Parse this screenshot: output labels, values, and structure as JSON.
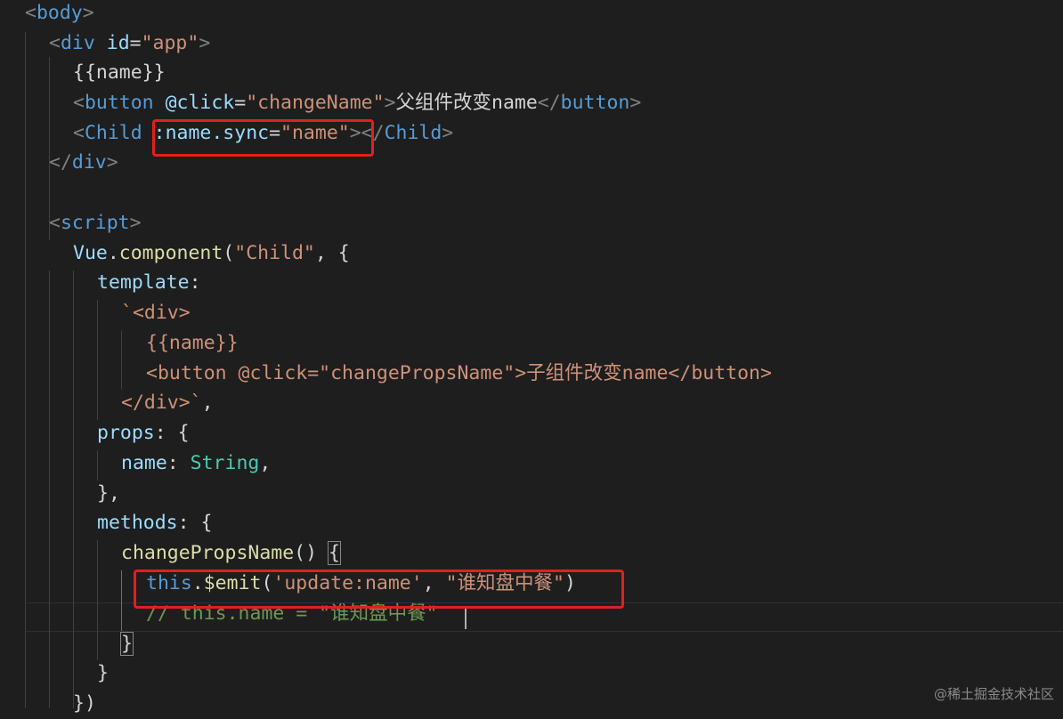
{
  "theme": {
    "background": "#1e1e1e",
    "tag": "#569cd6",
    "bracket": "#808080",
    "attribute": "#9cdcfe",
    "string": "#ce9178",
    "text": "#d4d4d4",
    "function": "#dcdcaa",
    "type": "#4ec9b0",
    "comment": "#6a9955",
    "highlight_box": "#e0201f"
  },
  "code_lines": [
    [
      {
        "t": "<",
        "c": "bracket"
      },
      {
        "t": "body",
        "c": "tag"
      },
      {
        "t": ">",
        "c": "bracket"
      }
    ],
    [
      {
        "t": "<",
        "c": "bracket"
      },
      {
        "t": "div",
        "c": "tag"
      },
      {
        "t": " "
      },
      {
        "t": "id",
        "c": "attribute"
      },
      {
        "t": "="
      },
      {
        "t": "\"app\"",
        "c": "string"
      },
      {
        "t": ">",
        "c": "bracket"
      }
    ],
    [
      {
        "t": "{{name}}"
      }
    ],
    [
      {
        "t": "<",
        "c": "bracket"
      },
      {
        "t": "button",
        "c": "tag"
      },
      {
        "t": " "
      },
      {
        "t": "@click",
        "c": "attribute"
      },
      {
        "t": "="
      },
      {
        "t": "\"changeName\"",
        "c": "string"
      },
      {
        "t": ">",
        "c": "bracket"
      },
      {
        "t": "父组件改变name"
      },
      {
        "t": "</",
        "c": "bracket"
      },
      {
        "t": "button",
        "c": "tag"
      },
      {
        "t": ">",
        "c": "bracket"
      }
    ],
    [
      {
        "t": "<",
        "c": "bracket"
      },
      {
        "t": "Child",
        "c": "tag"
      },
      {
        "t": " "
      },
      {
        "t": ":name.sync",
        "c": "attribute"
      },
      {
        "t": "="
      },
      {
        "t": "\"name\"",
        "c": "string"
      },
      {
        "t": "></",
        "c": "bracket"
      },
      {
        "t": "Child",
        "c": "tag"
      },
      {
        "t": ">",
        "c": "bracket"
      }
    ],
    [
      {
        "t": "</",
        "c": "bracket"
      },
      {
        "t": "div",
        "c": "tag"
      },
      {
        "t": ">",
        "c": "bracket"
      }
    ],
    [],
    [
      {
        "t": "<",
        "c": "bracket"
      },
      {
        "t": "script",
        "c": "tag"
      },
      {
        "t": ">",
        "c": "bracket"
      }
    ],
    [
      {
        "t": "Vue",
        "c": "attribute"
      },
      {
        "t": "."
      },
      {
        "t": "component",
        "c": "function"
      },
      {
        "t": "("
      },
      {
        "t": "\"Child\"",
        "c": "string"
      },
      {
        "t": ", {"
      }
    ],
    [
      {
        "t": "template",
        "c": "attribute"
      },
      {
        "t": ":"
      }
    ],
    [
      {
        "t": "`<div>",
        "c": "string"
      }
    ],
    [
      {
        "t": "{{name}}",
        "c": "string"
      }
    ],
    [
      {
        "t": "<button @click=\"changePropsName\">子组件改变name</button>",
        "c": "string"
      }
    ],
    [
      {
        "t": "</div>`",
        "c": "string"
      },
      {
        "t": ","
      }
    ],
    [
      {
        "t": "props",
        "c": "attribute"
      },
      {
        "t": ": {"
      }
    ],
    [
      {
        "t": "name",
        "c": "attribute"
      },
      {
        "t": ": "
      },
      {
        "t": "String",
        "c": "type"
      },
      {
        "t": ","
      }
    ],
    [
      {
        "t": "},"
      }
    ],
    [
      {
        "t": "methods",
        "c": "attribute"
      },
      {
        "t": ": {"
      }
    ],
    [
      {
        "t": "changePropsName",
        "c": "function"
      },
      {
        "t": "() "
      },
      {
        "t": "{",
        "b": 1
      }
    ],
    [
      {
        "t": "this",
        "c": "tag"
      },
      {
        "t": "."
      },
      {
        "t": "$emit",
        "c": "function"
      },
      {
        "t": "("
      },
      {
        "t": "'update:name'",
        "c": "string"
      },
      {
        "t": ", "
      },
      {
        "t": "\"谁知盘中餐\"",
        "c": "string"
      },
      {
        "t": ")"
      }
    ],
    [
      {
        "t": "// this.name = \"谁知盘中餐\"",
        "c": "comment"
      }
    ],
    [
      {
        "t": "}",
        "b": 1
      }
    ],
    [
      {
        "t": "}"
      }
    ],
    [
      {
        "t": "})"
      }
    ]
  ],
  "watermark": "@稀土掘金技术社区"
}
